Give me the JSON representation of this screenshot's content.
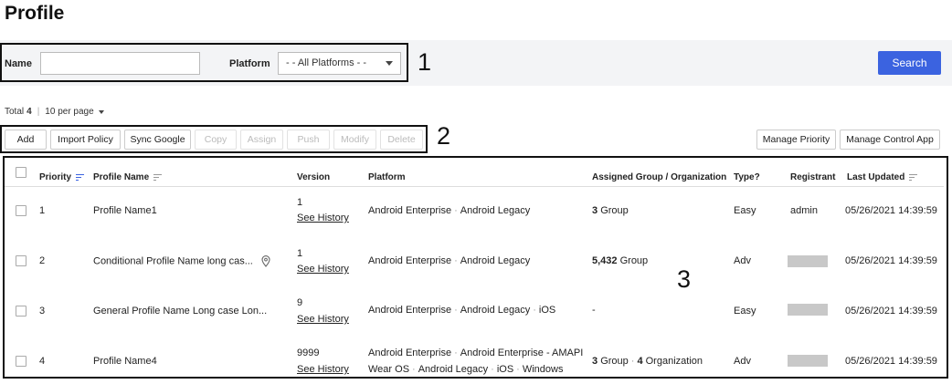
{
  "page": {
    "title": "Profile"
  },
  "search": {
    "name_label": "Name",
    "name_value": "",
    "name_placeholder": "",
    "platform_label": "Platform",
    "platform_selected": "- - All Platforms - -",
    "search_label": "Search"
  },
  "summary": {
    "total_label": "Total",
    "total_count": "4",
    "per_page": "10 per page"
  },
  "toolbar": {
    "add": "Add",
    "import_policy": "Import Policy",
    "sync_google": "Sync Google",
    "copy": "Copy",
    "assign": "Assign",
    "push": "Push",
    "modify": "Modify",
    "delete": "Delete",
    "manage_priority": "Manage Priority",
    "manage_control_app": "Manage Control App"
  },
  "annotations": {
    "one": "1",
    "two": "2",
    "three": "3"
  },
  "table": {
    "headers": {
      "priority": "Priority",
      "profile_name": "Profile Name",
      "version": "Version",
      "platform": "Platform",
      "assigned": "Assigned Group / Organization",
      "type": "Type?",
      "registrant": "Registrant",
      "last_updated": "Last Updated"
    },
    "see_history": "See History",
    "rows": [
      {
        "priority": "1",
        "name": "Profile Name1",
        "version": "1",
        "platform_line1": [
          "Android Enterprise",
          "Android Legacy"
        ],
        "platform_line2": [],
        "assigned_a_num": "3",
        "assigned_a_unit": "Group",
        "assigned_b_num": "",
        "assigned_b_unit": "",
        "type": "Easy",
        "registrant": "admin",
        "updated": "05/26/2021 14:39:59"
      },
      {
        "priority": "2",
        "name": "Conditional Profile Name long cas...",
        "version": "1",
        "platform_line1": [
          "Android Enterprise",
          "Android Legacy"
        ],
        "platform_line2": [],
        "assigned_a_num": "5,432",
        "assigned_a_unit": "Group",
        "assigned_b_num": "",
        "assigned_b_unit": "",
        "type": "Adv",
        "registrant": "",
        "updated": "05/26/2021 14:39:59"
      },
      {
        "priority": "3",
        "name": "General Profile Name Long case Lon...",
        "version": "9",
        "platform_line1": [
          "Android Enterprise",
          "Android Legacy",
          "iOS"
        ],
        "platform_line2": [],
        "assigned_a_num": "-",
        "assigned_a_unit": "",
        "assigned_b_num": "",
        "assigned_b_unit": "",
        "type": "Easy",
        "registrant": "",
        "updated": "05/26/2021 14:39:59"
      },
      {
        "priority": "4",
        "name": "Profile Name4",
        "version": "9999",
        "platform_line1": [
          "Android Enterprise",
          "Android Enterprise - AMAPI"
        ],
        "platform_line2": [
          "Wear OS",
          "Android Legacy",
          "iOS",
          "Windows"
        ],
        "assigned_a_num": "3",
        "assigned_a_unit": "Group",
        "assigned_b_num": "4",
        "assigned_b_unit": "Organization",
        "type": "Adv",
        "registrant": "",
        "updated": "05/26/2021 14:39:59"
      }
    ]
  },
  "colors": {
    "primary": "#3b63e0",
    "search_bg": "#f3f4f6",
    "redacted": "#c8c8c8"
  },
  "icons": {
    "sort": "sort-lines-icon",
    "location": "location-pin-icon",
    "dropdown": "chevron-down-icon"
  }
}
